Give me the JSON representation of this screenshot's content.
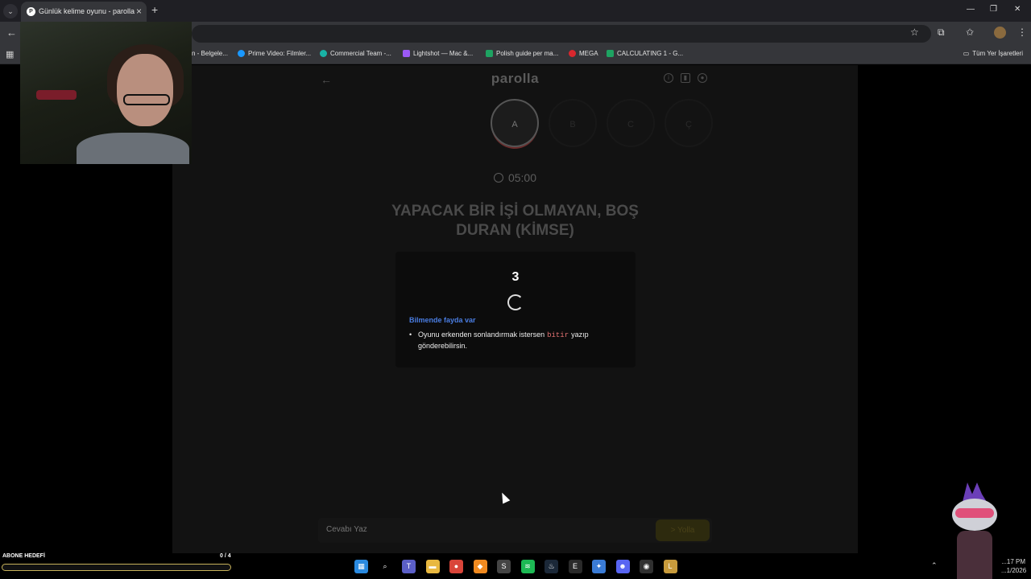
{
  "browser": {
    "tab_title": "Günlük kelime oyunu - parolla",
    "new_tab_symbol": "+",
    "tab_close_symbol": "×",
    "window_controls": [
      "—",
      "❐",
      "✕"
    ],
    "bookmarks": [
      {
        "label": "n - Belgele...",
        "icon": "bookmark-icon",
        "color": "#555"
      },
      {
        "label": "Prime Video: Filmler...",
        "icon": "prime-video-icon",
        "color": "#1a98ff"
      },
      {
        "label": "Commercial Team -...",
        "icon": "commercial-team-icon",
        "color": "#19b3a6"
      },
      {
        "label": "Lightshot — Mac &...",
        "icon": "lightshot-icon",
        "color": "#9b59f6"
      },
      {
        "label": "Polish guide per ma...",
        "icon": "sheets-icon",
        "color": "#1ea362"
      },
      {
        "label": "MEGA",
        "icon": "mega-icon",
        "color": "#d9272e"
      },
      {
        "label": "CALCULATING 1 - G...",
        "icon": "sheets-icon",
        "color": "#1ea362"
      }
    ],
    "all_bookmarks_label": "Tüm Yer İşaretleri"
  },
  "game": {
    "brand": "parolla",
    "letters": [
      "A",
      "B",
      "C",
      "Ç"
    ],
    "active_letter_index": 0,
    "timer": "05:00",
    "question": "YAPACAK BİR İŞİ OLMAYAN, BOŞ DURAN (KİMSE)",
    "countdown": "3",
    "tip_title": "Bilmende fayda var",
    "tip_text_before": "Oyunu erkenden sonlandırmak istersen",
    "tip_code": "bitir",
    "tip_text_after": "yazıp gönderebilirsin.",
    "answer_placeholder": "Cevabı Yaz",
    "send_label": "> Yolla",
    "accent_color": "#4a7de2"
  },
  "stream": {
    "goal_label": "ABONE HEDEFİ",
    "goal_count": "0 / 4",
    "goal_progress": 0
  },
  "taskbar": {
    "apps": [
      {
        "name": "windows-start-icon",
        "color": "#2a8ae0",
        "glyph": "▦"
      },
      {
        "name": "search-icon",
        "color": "#000",
        "glyph": "⌕"
      },
      {
        "name": "teams-icon",
        "color": "#5b5fc7",
        "glyph": "T"
      },
      {
        "name": "file-explorer-icon",
        "color": "#e8b840",
        "glyph": "▬"
      },
      {
        "name": "chrome-icon",
        "color": "#d9453a",
        "glyph": "●"
      },
      {
        "name": "app-orange-icon",
        "color": "#f08a20",
        "glyph": "◆"
      },
      {
        "name": "app-note-icon",
        "color": "#444",
        "glyph": "S"
      },
      {
        "name": "spotify-icon",
        "color": "#1db954",
        "glyph": "≋"
      },
      {
        "name": "steam-icon",
        "color": "#1b2838",
        "glyph": "♨"
      },
      {
        "name": "epic-games-icon",
        "color": "#2a2a2a",
        "glyph": "E"
      },
      {
        "name": "app-blue-icon",
        "color": "#3a7bd5",
        "glyph": "✦"
      },
      {
        "name": "discord-icon",
        "color": "#5865f2",
        "glyph": "☻"
      },
      {
        "name": "obs-icon",
        "color": "#303030",
        "glyph": "◉"
      },
      {
        "name": "league-icon",
        "color": "#c89b3c",
        "glyph": "L"
      }
    ],
    "time": "...17 PM",
    "date": "...1/2026"
  }
}
